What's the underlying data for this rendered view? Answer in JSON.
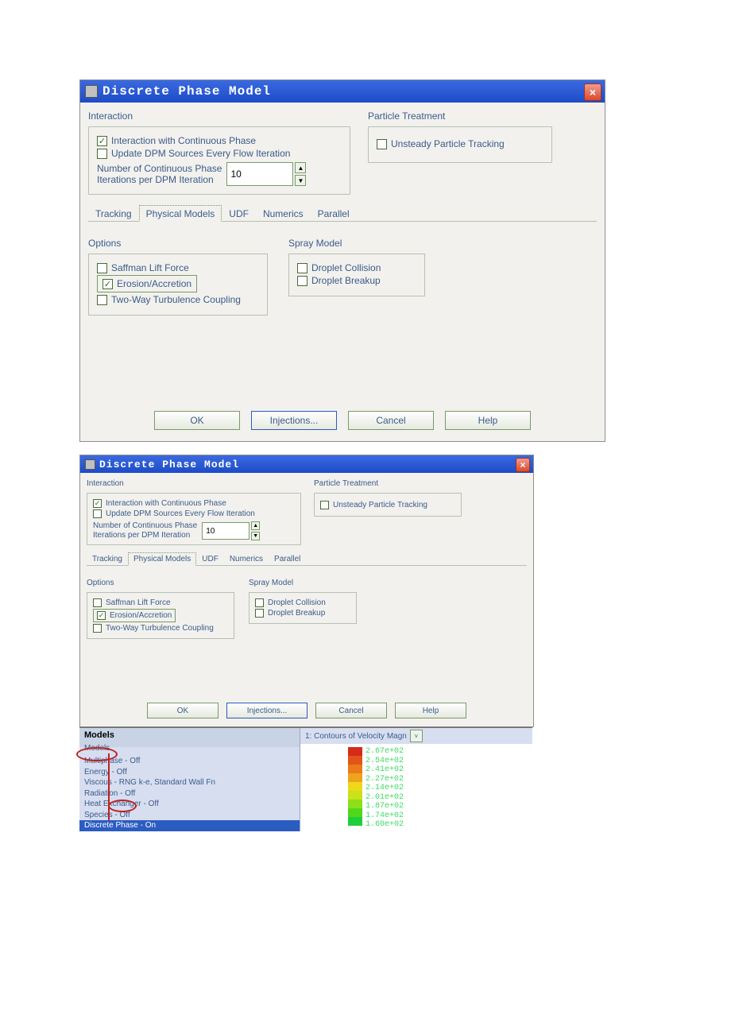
{
  "dialog1": {
    "title": "Discrete Phase Model",
    "close": "×",
    "interaction": {
      "heading": "Interaction",
      "chk_continuous": "Interaction with Continuous Phase",
      "chk_update": "Update DPM Sources Every Flow Iteration",
      "num_label1": "Number of Continuous Phase",
      "num_label2": "Iterations per DPM Iteration",
      "num_value": "10"
    },
    "particle": {
      "heading": "Particle Treatment",
      "chk_unsteady": "Unsteady Particle Tracking"
    },
    "tabs": {
      "tracking": "Tracking",
      "physical": "Physical Models",
      "udf": "UDF",
      "numerics": "Numerics",
      "parallel": "Parallel"
    },
    "options": {
      "heading": "Options",
      "saffman": "Saffman Lift Force",
      "erosion": "Erosion/Accretion",
      "twoway": "Two-Way Turbulence Coupling"
    },
    "spray": {
      "heading": "Spray Model",
      "collision": "Droplet Collision",
      "breakup": "Droplet Breakup"
    },
    "buttons": {
      "ok": "OK",
      "injections": "Injections...",
      "cancel": "Cancel",
      "help": "Help"
    }
  },
  "fluent": {
    "models_hdr": "Models",
    "models_sub": "Models",
    "items": [
      "Multiphase - Off",
      "Energy - Off",
      "Viscous - RNG k-e, Standard Wall Fn",
      "Radiation - Off",
      "Heat Exchanger - Off",
      "Species - Off",
      "Discrete Phase - On"
    ],
    "viewer_title": "1: Contours of Velocity Magn",
    "legend_values": [
      "2.67e+02",
      "2.54e+02",
      "2.41e+02",
      "2.27e+02",
      "2.14e+02",
      "2.01e+02",
      "1.87e+02",
      "1.74e+02",
      "1.60e+02"
    ],
    "legend_colors": [
      "#d62a1a",
      "#e2551a",
      "#ea7a1a",
      "#efa31a",
      "#efd81a",
      "#c9e21a",
      "#8ede1a",
      "#4fd81a",
      "#1fcf39"
    ]
  }
}
